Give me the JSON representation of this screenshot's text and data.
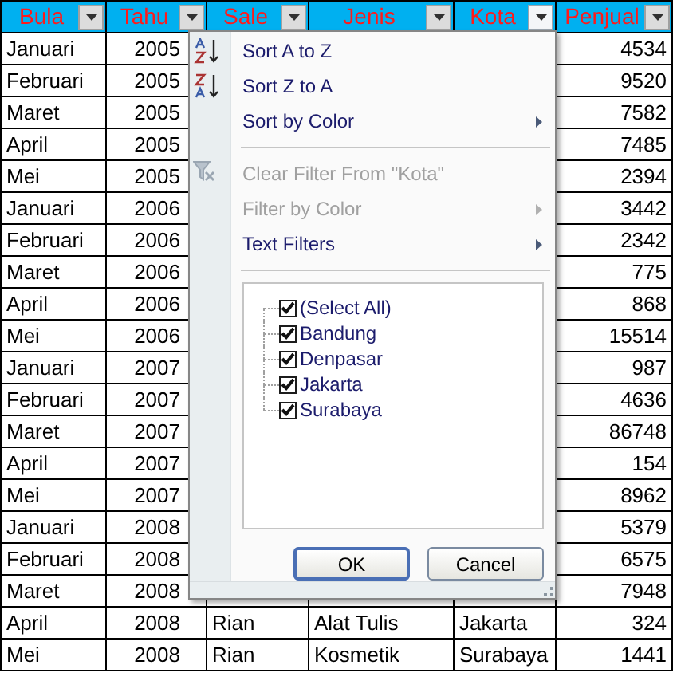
{
  "table": {
    "columns": [
      {
        "label": "Bula",
        "filter_open": false
      },
      {
        "label": "Tahu",
        "filter_open": false
      },
      {
        "label": "Sale",
        "filter_open": false
      },
      {
        "label": "Jenis",
        "filter_open": false
      },
      {
        "label": "Kota",
        "filter_open": true
      },
      {
        "label": "Penjual",
        "filter_open": false
      }
    ],
    "rows": [
      {
        "bulan": "Januari",
        "tahun": "2005",
        "penjualan": "4534"
      },
      {
        "bulan": "Februari",
        "tahun": "2005",
        "penjualan": "9520"
      },
      {
        "bulan": "Maret",
        "tahun": "2005",
        "penjualan": "7582"
      },
      {
        "bulan": "April",
        "tahun": "2005",
        "penjualan": "7485"
      },
      {
        "bulan": "Mei",
        "tahun": "2005",
        "penjualan": "2394"
      },
      {
        "bulan": "Januari",
        "tahun": "2006",
        "penjualan": "3442"
      },
      {
        "bulan": "Februari",
        "tahun": "2006",
        "penjualan": "2342"
      },
      {
        "bulan": "Maret",
        "tahun": "2006",
        "penjualan": "775"
      },
      {
        "bulan": "April",
        "tahun": "2006",
        "penjualan": "868"
      },
      {
        "bulan": "Mei",
        "tahun": "2006",
        "penjualan": "15514"
      },
      {
        "bulan": "Januari",
        "tahun": "2007",
        "penjualan": "987"
      },
      {
        "bulan": "Februari",
        "tahun": "2007",
        "penjualan": "4636"
      },
      {
        "bulan": "Maret",
        "tahun": "2007",
        "penjualan": "86748"
      },
      {
        "bulan": "April",
        "tahun": "2007",
        "penjualan": "154"
      },
      {
        "bulan": "Mei",
        "tahun": "2007",
        "penjualan": "8962"
      },
      {
        "bulan": "Januari",
        "tahun": "2008",
        "penjualan": "5379"
      },
      {
        "bulan": "Februari",
        "tahun": "2008",
        "penjualan": "6575"
      },
      {
        "bulan": "Maret",
        "tahun": "2008",
        "penjualan": "7948"
      },
      {
        "bulan": "April",
        "tahun": "2008",
        "sales": "Rian",
        "jenis": "Alat Tulis",
        "kota": "Jakarta",
        "penjualan": "324"
      },
      {
        "bulan": "Mei",
        "tahun": "2008",
        "sales": "Rian",
        "jenis": "Kosmetik",
        "kota": "Surabaya",
        "penjualan": "1441"
      }
    ]
  },
  "filter_menu": {
    "items": [
      {
        "kind": "sort-az",
        "label": "Sort A to Z",
        "disabled": false,
        "submenu": false
      },
      {
        "kind": "sort-za",
        "label": "Sort Z to A",
        "disabled": false,
        "submenu": false
      },
      {
        "kind": "plain",
        "label": "Sort by Color",
        "disabled": false,
        "submenu": true
      },
      {
        "kind": "separator"
      },
      {
        "kind": "clear-filter",
        "label": "Clear Filter From \"Kota\"",
        "disabled": true,
        "submenu": false
      },
      {
        "kind": "plain",
        "label": "Filter by Color",
        "disabled": true,
        "submenu": true
      },
      {
        "kind": "plain",
        "label": "Text Filters",
        "disabled": false,
        "submenu": true
      },
      {
        "kind": "separator"
      }
    ],
    "values": [
      {
        "label": "(Select All)",
        "checked": true
      },
      {
        "label": "Bandung",
        "checked": true
      },
      {
        "label": "Denpasar",
        "checked": true
      },
      {
        "label": "Jakarta",
        "checked": true
      },
      {
        "label": "Surabaya",
        "checked": true
      }
    ],
    "buttons": [
      "OK",
      "Cancel"
    ]
  }
}
